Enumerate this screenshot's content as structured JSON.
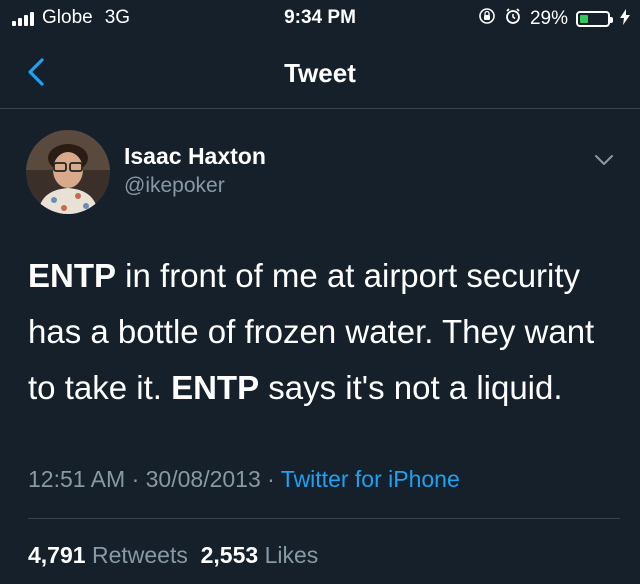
{
  "status_bar": {
    "carrier": "Globe",
    "network": "3G",
    "time": "9:34 PM",
    "battery_percent": "29%",
    "battery_level": 0.29,
    "icons": [
      "signal-bars-icon",
      "rotation-lock-icon",
      "alarm-icon",
      "battery-icon",
      "charging-bolt-icon"
    ]
  },
  "nav": {
    "title": "Tweet",
    "back_icon": "chevron-left-icon"
  },
  "tweet": {
    "author_name": "Isaac Haxton",
    "author_handle": "@ikepoker",
    "body": {
      "line1_bold": "ENTP",
      "line1_rest": " in front of me at airport security",
      "line2": "has a bottle of frozen water. They want",
      "line3_start": "to take it. ",
      "line3_bold": "ENTP",
      "line3_rest": " says it's not a liquid."
    },
    "time": "12:51 AM",
    "date": "30/08/2013",
    "separator": " · ",
    "source": "Twitter for iPhone",
    "retweets_count": "4,791",
    "retweets_label": "Retweets",
    "likes_count": "2,553",
    "likes_label": "Likes"
  },
  "colors": {
    "background": "#15202b",
    "secondary_text": "#8899a6",
    "link": "#1da1f2",
    "divider": "#38444d",
    "battery_green": "#34c759"
  }
}
